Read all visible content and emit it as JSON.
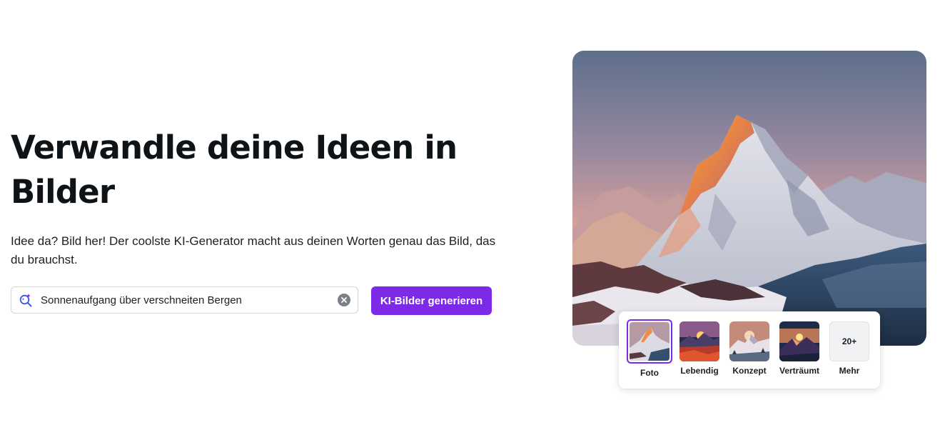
{
  "hero": {
    "headline": "Verwandle deine Ideen in Bilder",
    "subline": "Idee da? Bild her! Der coolste KI-Generator macht aus deinen Worten genau das Bild, das du brauchst."
  },
  "search": {
    "value": "Sonnenaufgang über verschneiten Bergen",
    "icon": "ai-search-icon",
    "clear_icon": "clear-icon"
  },
  "generate_button": {
    "label": "KI-Bilder generieren",
    "color": "#7d2ae8"
  },
  "image": {
    "subject": "snowy-mountain-sunrise-image"
  },
  "styles": {
    "selected": "Foto",
    "items": [
      {
        "label": "Foto"
      },
      {
        "label": "Lebendig"
      },
      {
        "label": "Konzept"
      },
      {
        "label": "Verträumt"
      },
      {
        "label": "Mehr",
        "badge": "20+"
      }
    ]
  },
  "colors": {
    "accent": "#7d2ae8",
    "text": "#0e1318"
  }
}
